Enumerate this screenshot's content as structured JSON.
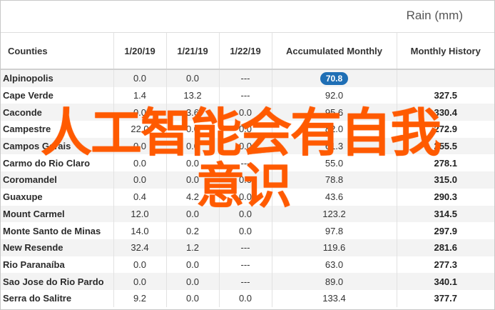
{
  "unit_label": "Rain (mm)",
  "columns": [
    "Counties",
    "1/20/19",
    "1/21/19",
    "1/22/19",
    "Accumulated Monthly",
    "Monthly History"
  ],
  "rows": [
    {
      "name": "Alpinopolis",
      "d1": "0.0",
      "d2": "0.0",
      "d3": "---",
      "acc": "70.8",
      "hist": ""
    },
    {
      "name": "Cape Verde",
      "d1": "1.4",
      "d2": "13.2",
      "d3": "---",
      "acc": "92.0",
      "hist": "327.5"
    },
    {
      "name": "Caconde",
      "d1": "0.0",
      "d2": "3.6",
      "d3": "0.0",
      "acc": "95.6",
      "hist": "330.4"
    },
    {
      "name": "Campestre",
      "d1": "22.0",
      "d2": "0.0",
      "d3": "0.0",
      "acc": "82.0",
      "hist": "272.9"
    },
    {
      "name": "Campos Gerais",
      "d1": "0.0",
      "d2": "0.0",
      "d3": "0.0",
      "acc": "61.3",
      "hist": "255.5"
    },
    {
      "name": "Carmo do Rio Claro",
      "d1": "0.0",
      "d2": "0.0",
      "d3": "---",
      "acc": "55.0",
      "hist": "278.1"
    },
    {
      "name": "Coromandel",
      "d1": "0.0",
      "d2": "0.0",
      "d3": "0.0",
      "acc": "78.8",
      "hist": "315.0"
    },
    {
      "name": "Guaxupe",
      "d1": "0.4",
      "d2": "4.2",
      "d3": "0.0",
      "acc": "43.6",
      "hist": "290.3"
    },
    {
      "name": "Mount Carmel",
      "d1": "12.0",
      "d2": "0.0",
      "d3": "0.0",
      "acc": "123.2",
      "hist": "314.5"
    },
    {
      "name": "Monte Santo de Minas",
      "d1": "14.0",
      "d2": "0.2",
      "d3": "0.0",
      "acc": "97.8",
      "hist": "297.9"
    },
    {
      "name": "New Resende",
      "d1": "32.4",
      "d2": "1.2",
      "d3": "---",
      "acc": "119.6",
      "hist": "281.6"
    },
    {
      "name": "Rio Paranaíba",
      "d1": "0.0",
      "d2": "0.0",
      "d3": "---",
      "acc": "63.0",
      "hist": "277.3"
    },
    {
      "name": "Sao Jose do Rio Pardo",
      "d1": "0.0",
      "d2": "0.0",
      "d3": "---",
      "acc": "89.0",
      "hist": "340.1"
    },
    {
      "name": "Serra do Salitre",
      "d1": "9.2",
      "d2": "0.0",
      "d3": "0.0",
      "acc": "133.4",
      "hist": "377.7"
    }
  ],
  "overlay": {
    "line1": "人工智能会有自我",
    "line2": "意识",
    "color": "#ff5a00"
  }
}
